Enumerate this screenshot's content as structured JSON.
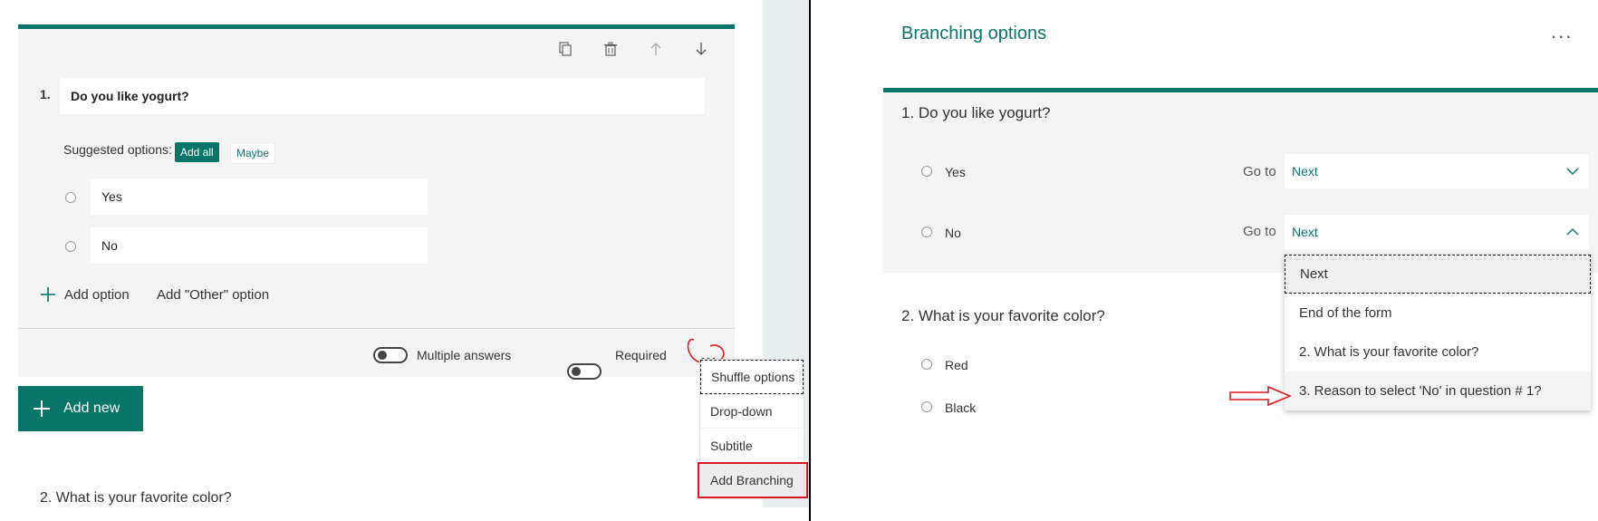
{
  "left": {
    "question1": {
      "number": "1.",
      "title": "Do you like yogurt?"
    },
    "suggested": {
      "label": "Suggested options:",
      "add_all": "Add all",
      "maybe": "Maybe"
    },
    "options": [
      "Yes",
      "No"
    ],
    "add_option": "Add option",
    "add_other": "Add \"Other\" option",
    "multiple_answers": "Multiple answers",
    "required": "Required",
    "add_new": "Add new",
    "question2": "2. What is your favorite color?",
    "menu": [
      "Shuffle options",
      "Drop-down",
      "Subtitle",
      "Add Branching"
    ]
  },
  "right": {
    "title": "Branching options",
    "more": "...",
    "question1": "1. Do you like yogurt?",
    "q1_options": [
      {
        "label": "Yes",
        "goto": "Go to",
        "value": "Next"
      },
      {
        "label": "No",
        "goto": "Go to",
        "value": "Next"
      }
    ],
    "question2": "2. What is your favorite color?",
    "q2_options": [
      "Red",
      "Black"
    ],
    "dropdown": [
      "Next",
      "End of the form",
      "2. What is your favorite color?",
      "3. Reason to select 'No' in question # 1?"
    ]
  },
  "colors": {
    "accent": "#077568",
    "annotation": "#d9191f"
  }
}
